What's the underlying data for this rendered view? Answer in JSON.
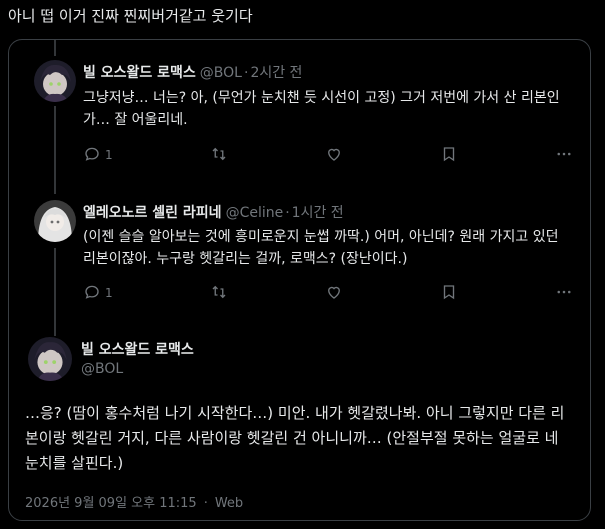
{
  "post": {
    "text": "아니 떱 이거 진짜 찐찌버거같고 웃기다"
  },
  "tweets": [
    {
      "name": "빌 오스왈드 로맥스",
      "handle": "@BOL",
      "time": "2시간 전",
      "body": "그냥저냥… 너는? 아, (무언가 눈치챈 듯 시선이 고정) 그거 저번에 가서 산 리본인가… 잘 어울리네.",
      "reply_count": "1"
    },
    {
      "name": "엘레오노르 셀린 라피네",
      "handle": "@Celine",
      "time": "1시간 전",
      "body": "(이젠 슬슬 알아보는 것에 흥미로운지 눈썹 까딱.) 어머, 아닌데? 원래 가지고 있던 리본이잖아. 누구랑 헷갈리는 걸까, 로맥스? (장난이다.)",
      "reply_count": "1"
    }
  ],
  "main": {
    "name": "빌 오스왈드 로맥스",
    "handle": "@BOL",
    "body": "…응? (땀이 홍수처럼 나기 시작한다…) 미안. 내가 헷갈렸나봐. 아니 그렇지만 다른 리본이랑 헷갈린 거지, 다른 사람이랑 헷갈린 건 아니니까… (안절부절 못하는 얼굴로 네 눈치를 살핀다.)",
    "datetime": "2026년 9월 09일 오후 11:15",
    "source": "Web"
  },
  "icons": {
    "reply": "reply-icon",
    "retweet": "retweet-icon",
    "like": "heart-icon",
    "bookmark": "bookmark-icon",
    "more": "more-icon"
  }
}
